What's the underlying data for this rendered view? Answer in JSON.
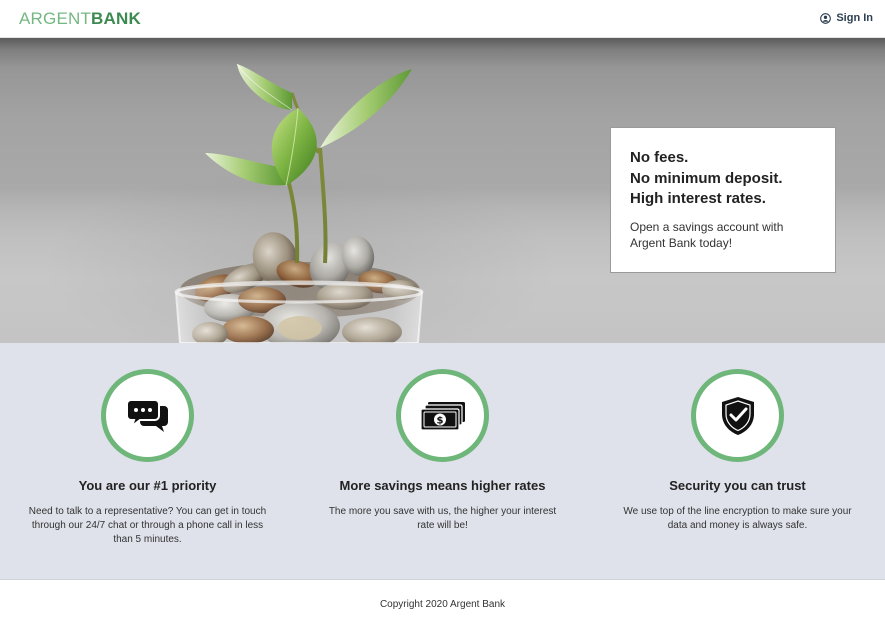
{
  "nav": {
    "logo_part1": "ARGENT",
    "logo_part2": "BANK",
    "signin_label": "Sign In",
    "signin_icon": "user-circle-icon"
  },
  "hero": {
    "image": "plant-in-jar-of-coins-image",
    "promo": {
      "headline_lines": [
        "No fees.",
        "No minimum deposit.",
        "High interest rates."
      ],
      "text": "Open a savings account with Argent Bank today!"
    }
  },
  "features": [
    {
      "icon": "chat-bubbles-icon",
      "title": "You are our #1 priority",
      "text": "Need to talk to a representative? You can get in touch through our 24/7 chat or through a phone call in less than 5 minutes."
    },
    {
      "icon": "money-bills-icon",
      "title": "More savings means higher rates",
      "text": "The more you save with us, the higher your interest rate will be!"
    },
    {
      "icon": "shield-check-icon",
      "title": "Security you can trust",
      "text": "We use top of the line encryption to make sure your data and money is always safe."
    }
  ],
  "footer": {
    "copyright": "Copyright 2020 Argent Bank"
  },
  "colors": {
    "brand_green": "#3d8a50",
    "brand_green_light": "#74b881",
    "feature_ring": "#6fb67a",
    "features_bg": "#dfe2ea"
  }
}
